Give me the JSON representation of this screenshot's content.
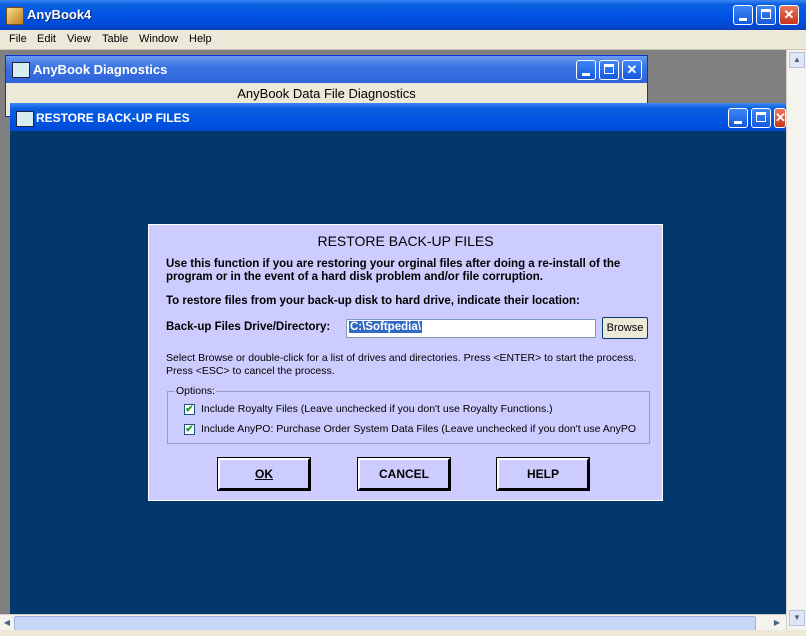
{
  "app": {
    "title": "AnyBook4",
    "menu": [
      "File",
      "Edit",
      "View",
      "Table",
      "Window",
      "Help"
    ]
  },
  "diagnostics_window": {
    "title": "AnyBook Diagnostics",
    "heading": "AnyBook Data File Diagnostics"
  },
  "restore_window": {
    "title": "RESTORE BACK-UP FILES"
  },
  "dialog": {
    "title": "RESTORE BACK-UP FILES",
    "intro": "Use this function if you are restoring your orginal files after doing a re-install of the program or in the event of a hard disk problem and/or file corruption.",
    "location_instruction": "To restore files from your back-up disk to hard drive, indicate their location:",
    "dir_label": "Back-up Files Drive/Directory:",
    "dir_value": "C:\\Softpedia\\",
    "browse_label": "Browse",
    "help_text": "Select Browse or double-click for a list of drives and directories.  Press <ENTER> to start the process.  Press <ESC> to cancel the process.",
    "options": {
      "legend": "Options:",
      "royalty_label": "Include Royalty Files (Leave unchecked if you don't use Royalty Functions.)",
      "royalty_checked": true,
      "anypo_label": "Include AnyPO: Purchase Order System Data Files (Leave unchecked if you don't use AnyPO",
      "anypo_checked": true
    },
    "buttons": {
      "ok": "OK",
      "cancel": "CANCEL",
      "help": "HELP"
    }
  }
}
